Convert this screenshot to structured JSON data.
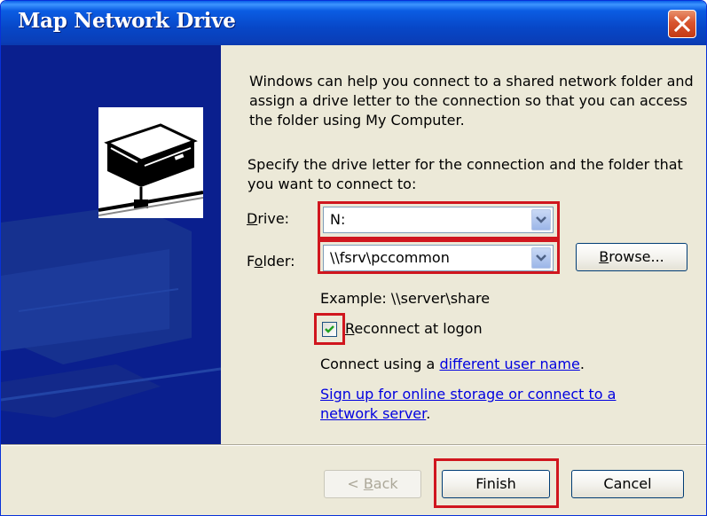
{
  "window": {
    "title": "Map Network Drive",
    "close_icon": "close-icon",
    "accent": "#0A5FE8"
  },
  "intro": {
    "text": "Windows can help you connect to a shared network folder and assign a drive letter to the connection so that you can access the folder using My Computer."
  },
  "specify": {
    "text": "Specify the drive letter for the connection and the folder that you want to connect to:"
  },
  "drive": {
    "label_prefix": "",
    "label_accel": "D",
    "label_rest": "rive:",
    "value": "N:"
  },
  "folder": {
    "label_prefix": "F",
    "label_accel": "o",
    "label_rest": "lder:",
    "value": "\\\\fsrv\\pccommon"
  },
  "browse_button": {
    "prefix": "",
    "accel": "B",
    "rest": "rowse..."
  },
  "example": {
    "text": "Example: \\\\server\\share"
  },
  "reconnect": {
    "accel": "R",
    "rest": "econnect at logon",
    "checked": true
  },
  "connect_using": {
    "prefix": "Connect using a ",
    "link": "different user name",
    "suffix": "."
  },
  "signup": {
    "link_line1": "Sign up for online storage or connect to a",
    "link_line2": "network server",
    "suffix": "."
  },
  "footer": {
    "back_prefix": "< ",
    "back_accel": "B",
    "back_rest": "ack",
    "finish": "Finish",
    "cancel": "Cancel"
  },
  "highlight_color": "#D0161E",
  "link_color": "#0000E0"
}
